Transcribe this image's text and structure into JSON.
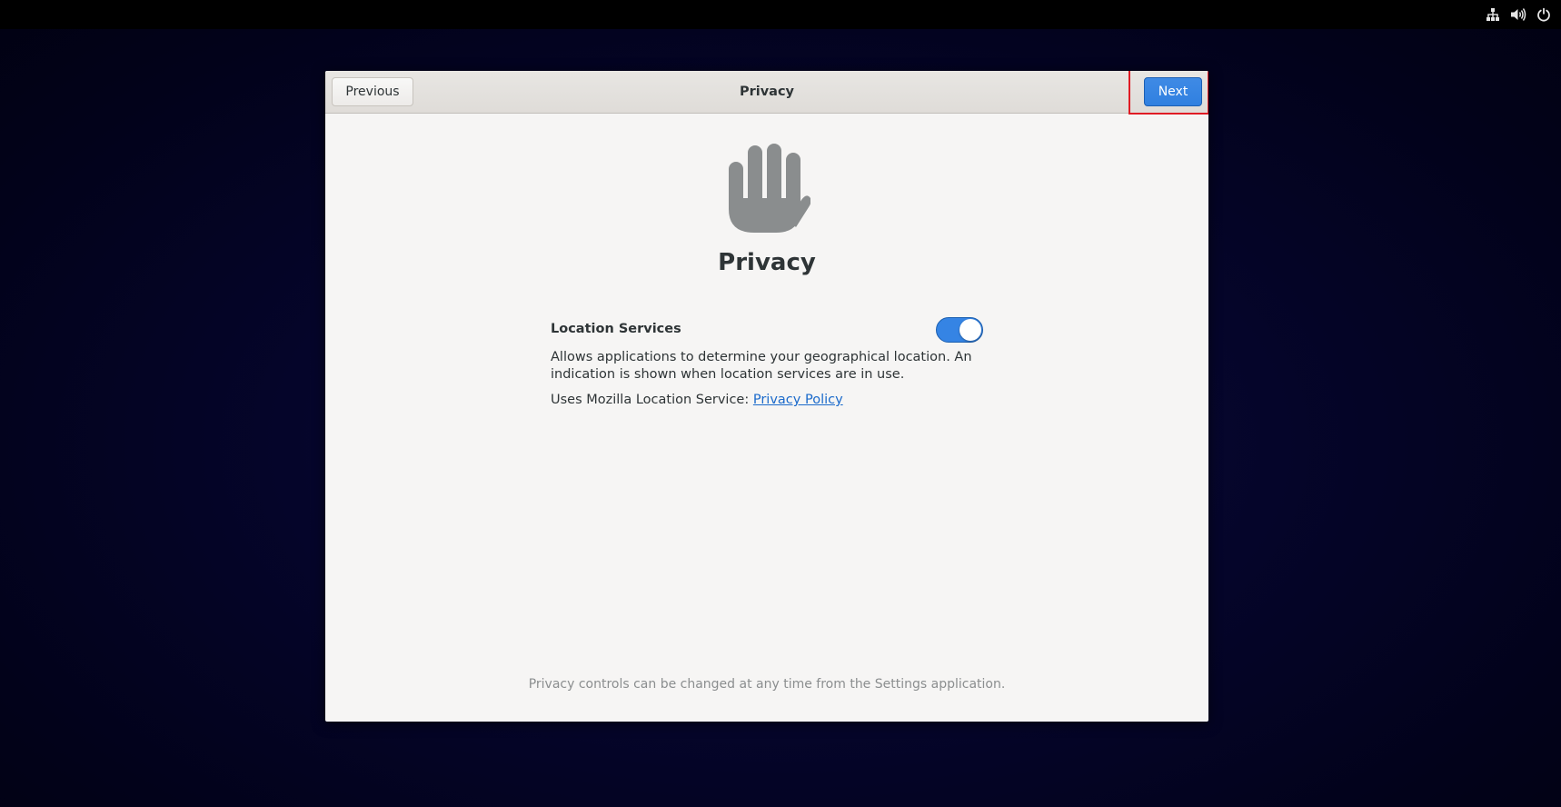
{
  "system_tray": {
    "icons": [
      "network-icon",
      "volume-icon",
      "power-icon"
    ]
  },
  "header": {
    "previous_label": "Previous",
    "title": "Privacy",
    "next_label": "Next"
  },
  "main": {
    "icon": "hand-stop-icon",
    "title": "Privacy",
    "location_services": {
      "label": "Location Services",
      "enabled": true,
      "description": "Allows applications to determine your geographical location. An indication is shown when location services are in use.",
      "uses_text": "Uses Mozilla Location Service: ",
      "policy_link": "Privacy Policy"
    },
    "footer_note": "Privacy controls can be changed at any time from the Settings application."
  },
  "colors": {
    "accent": "#3584e4",
    "highlight": "#e01b24",
    "link": "#1b6acb"
  }
}
